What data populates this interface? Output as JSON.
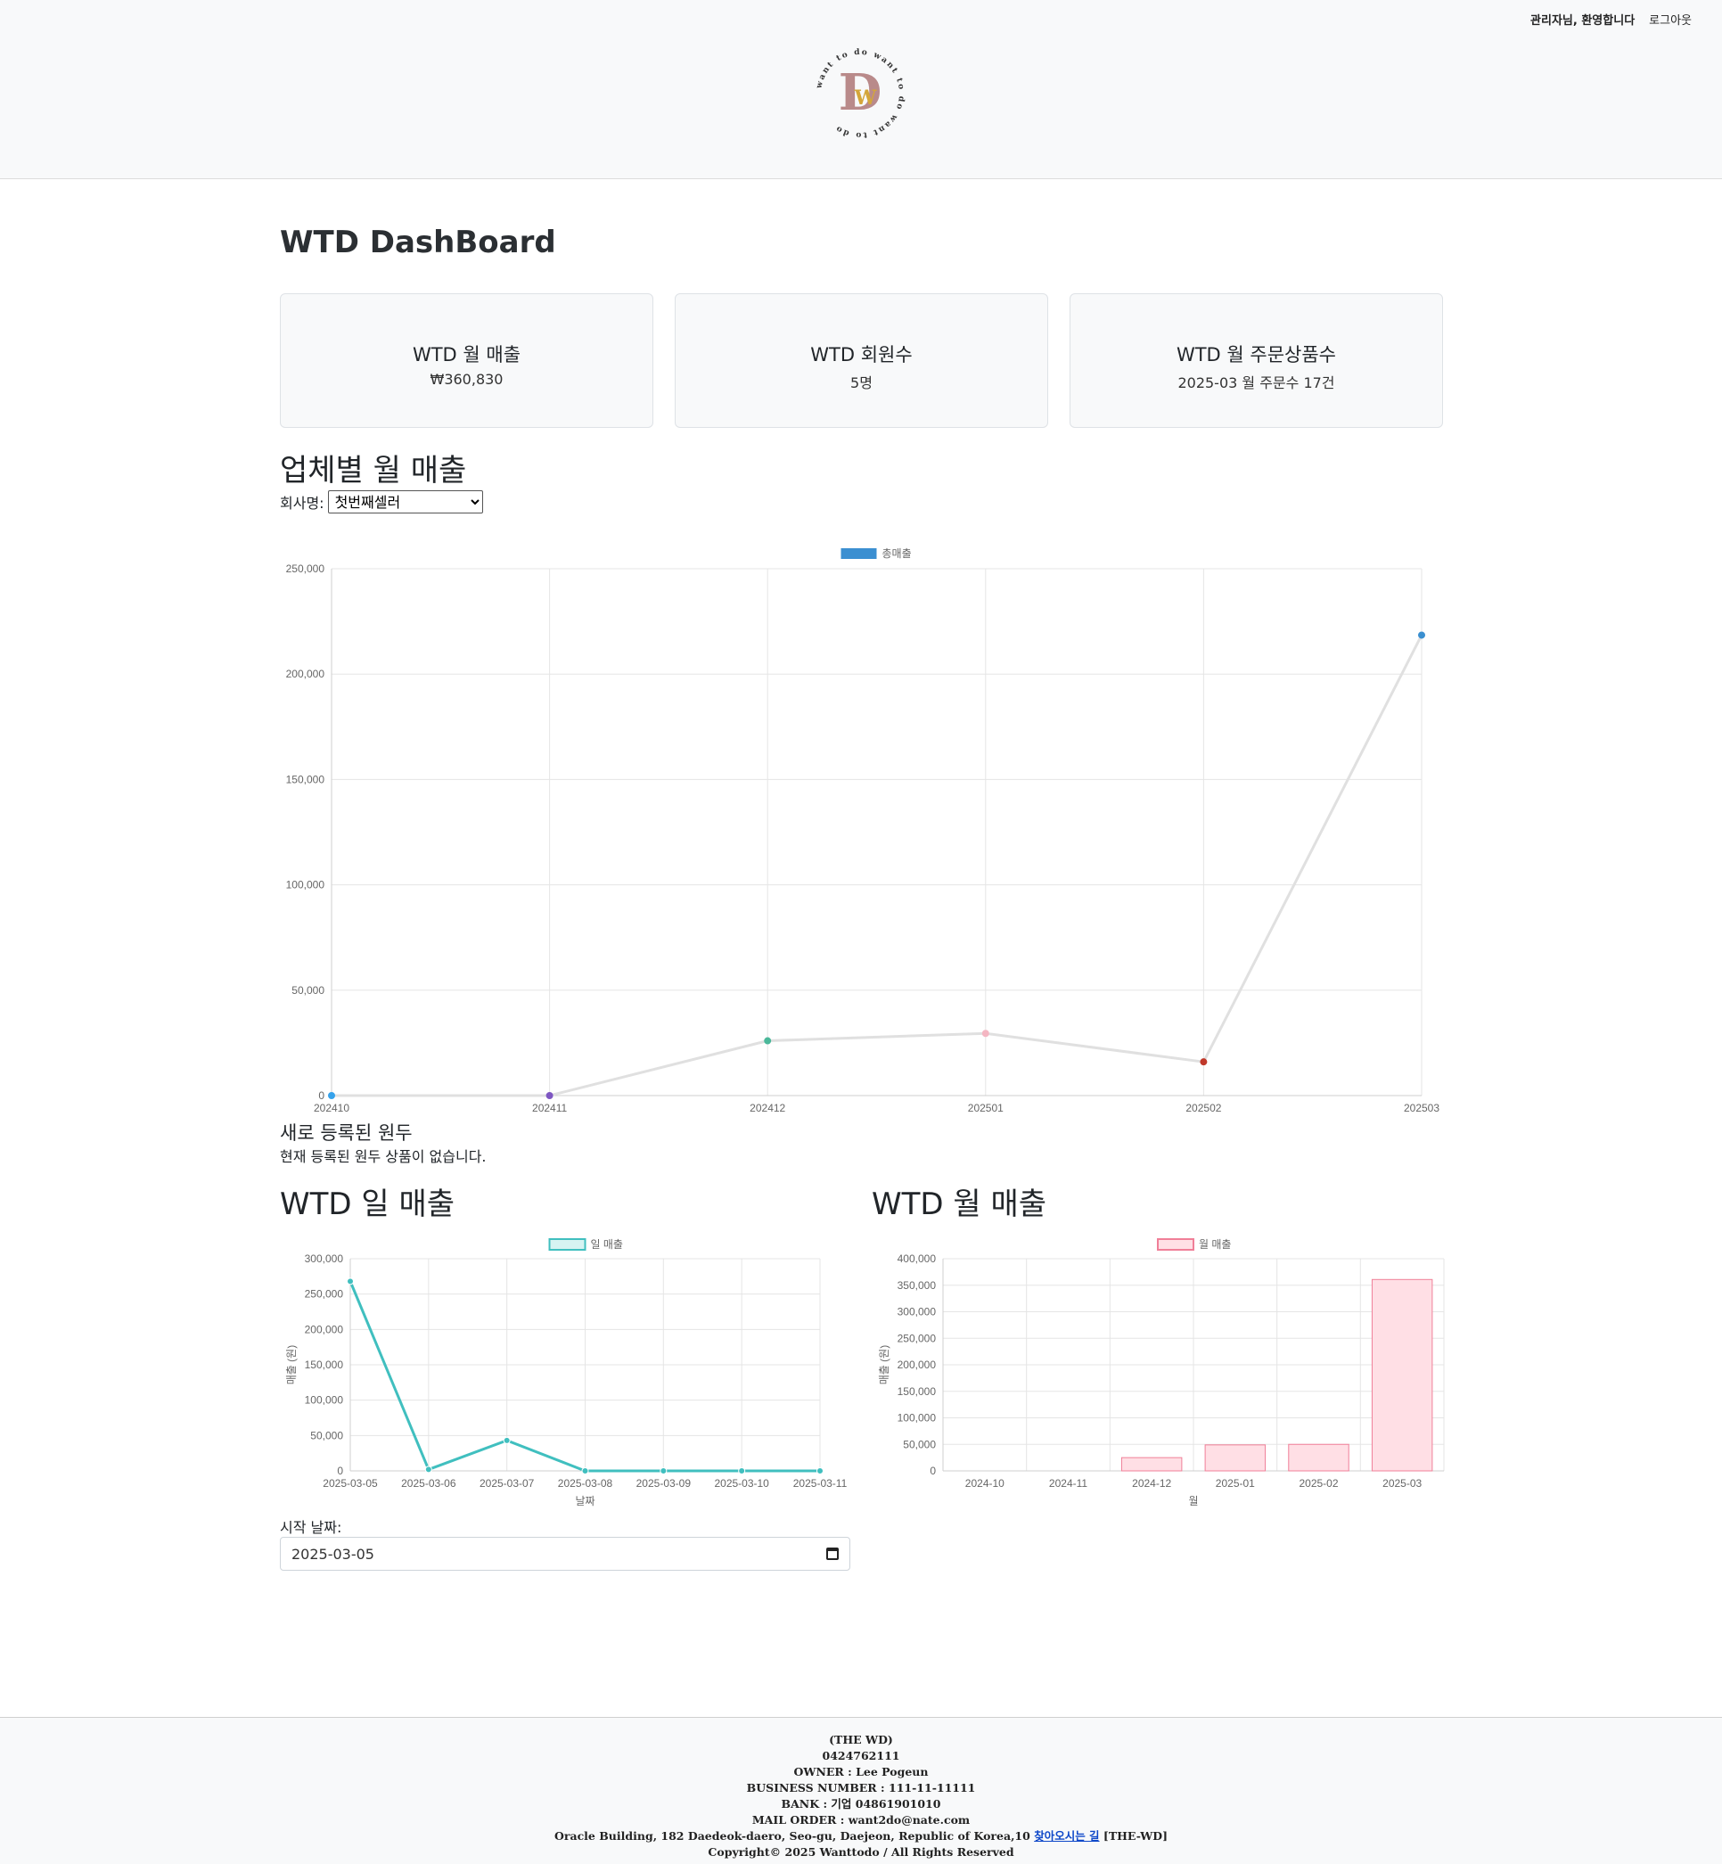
{
  "header": {
    "welcome": "관리자님, 환영합니다",
    "logout": "로그아웃",
    "logo_ring_text": "want to do want to do want to do",
    "logo_letters": "DW"
  },
  "page_title": "WTD DashBoard",
  "stats": [
    {
      "label": "WTD 월 매출",
      "value": "₩360,830"
    },
    {
      "label": "WTD 회원수",
      "value": "5명"
    },
    {
      "label": "WTD 월 주문상품수",
      "value": "2025-03 월 주문수 17건"
    }
  ],
  "company_sales": {
    "title": "업체별 월 매출",
    "select_label": "회사명:",
    "selected_company": "첫번째셀러"
  },
  "new_products": {
    "title": "새로 등록된 원두",
    "empty_text": "현재 등록된 원두 상품이 없습니다."
  },
  "daily_sales": {
    "title": "WTD 일 매출"
  },
  "monthly_sales": {
    "title": "WTD 월 매출"
  },
  "date_filter": {
    "label": "시작 날짜:",
    "value": "2025-03-05"
  },
  "chart_data": [
    {
      "type": "line",
      "legend": [
        "총매출"
      ],
      "categories": [
        "202410",
        "202411",
        "202412",
        "202501",
        "202502",
        "202503"
      ],
      "series": [
        {
          "name": "총매출",
          "values": [
            0,
            0,
            26000,
            29500,
            16000,
            218500
          ]
        }
      ],
      "ylim": [
        0,
        250000
      ],
      "yticks": [
        "0",
        "50,000",
        "100,000",
        "150,000",
        "200,000",
        "250,000"
      ],
      "point_colors": [
        "#36a2eb",
        "#7e57c2",
        "#4bb89a",
        "#f4b6c2",
        "#c0392b",
        "#3a8fd0"
      ],
      "line_color": "#e0e0e0",
      "legend_color": "#3b8fd1",
      "grid": true,
      "legend_position": "top"
    },
    {
      "type": "line",
      "legend": [
        "일 매출"
      ],
      "categories": [
        "2025-03-05",
        "2025-03-06",
        "2025-03-07",
        "2025-03-08",
        "2025-03-09",
        "2025-03-10",
        "2025-03-11"
      ],
      "series": [
        {
          "name": "일 매출",
          "values": [
            268000,
            2000,
            43000,
            0,
            0,
            0,
            0
          ]
        }
      ],
      "ylim": [
        0,
        300000
      ],
      "yticks": [
        "0",
        "50,000",
        "100,000",
        "150,000",
        "200,000",
        "250,000",
        "300,000"
      ],
      "xlabel": "날짜",
      "ylabel": "매출 (원)",
      "color": "#40bfbf",
      "grid": true,
      "legend_position": "top"
    },
    {
      "type": "bar",
      "legend": [
        "월 매출"
      ],
      "categories": [
        "2024-10",
        "2024-11",
        "2024-12",
        "2025-01",
        "2025-02",
        "2025-03"
      ],
      "series": [
        {
          "name": "월 매출",
          "values": [
            0,
            0,
            25000,
            49000,
            50000,
            360830
          ]
        }
      ],
      "ylim": [
        0,
        400000
      ],
      "yticks": [
        "0",
        "50,000",
        "100,000",
        "150,000",
        "200,000",
        "250,000",
        "300,000",
        "350,000",
        "400,000"
      ],
      "xlabel": "월",
      "ylabel": "매출 (원)",
      "color": "#ffdfe5",
      "border_color": "#f07f98",
      "grid": true,
      "legend_position": "top"
    }
  ],
  "footer": {
    "lines": [
      "(THE WD)",
      "0424762111",
      "OWNER : Lee Pogeun",
      "BUSINESS NUMBER : 111-11-11111",
      "BANK : 기업 04861901010",
      "MAIL ORDER : want2do@nate.com"
    ],
    "address": "Oracle Building, 182 Daedeok-daero, Seo-gu, Daejeon, Republic of Korea,10",
    "directions_link": "찾아오시는 길",
    "brand_suffix": "[THE-WD]",
    "copyright": "Copyright© 2025 Wanttodo / All Rights Reserved"
  }
}
